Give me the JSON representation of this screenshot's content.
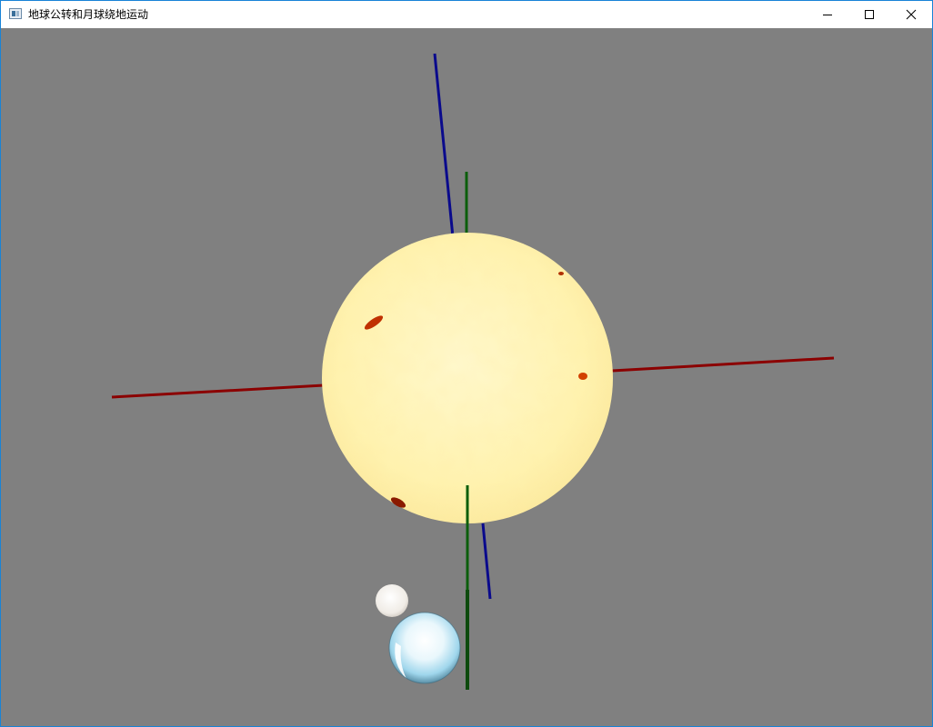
{
  "window": {
    "title": "地球公转和月球绕地运动",
    "icon": "app-window-icon",
    "controls": {
      "minimize_icon": "minimize-icon",
      "maximize_icon": "maximize-icon",
      "close_icon": "close-icon"
    }
  },
  "scene": {
    "background_color": "#808080",
    "axis_colors": {
      "x": "#8b0000",
      "y": "#0b5e0b",
      "z": "#0a0a8c"
    },
    "sun": {
      "color": "#fff3b0",
      "sunspot_color": "#c03000"
    },
    "earth": {
      "color": "#bfe6f5",
      "highlight": "#ffffff"
    },
    "moon": {
      "color": "#f2f0ec"
    }
  }
}
